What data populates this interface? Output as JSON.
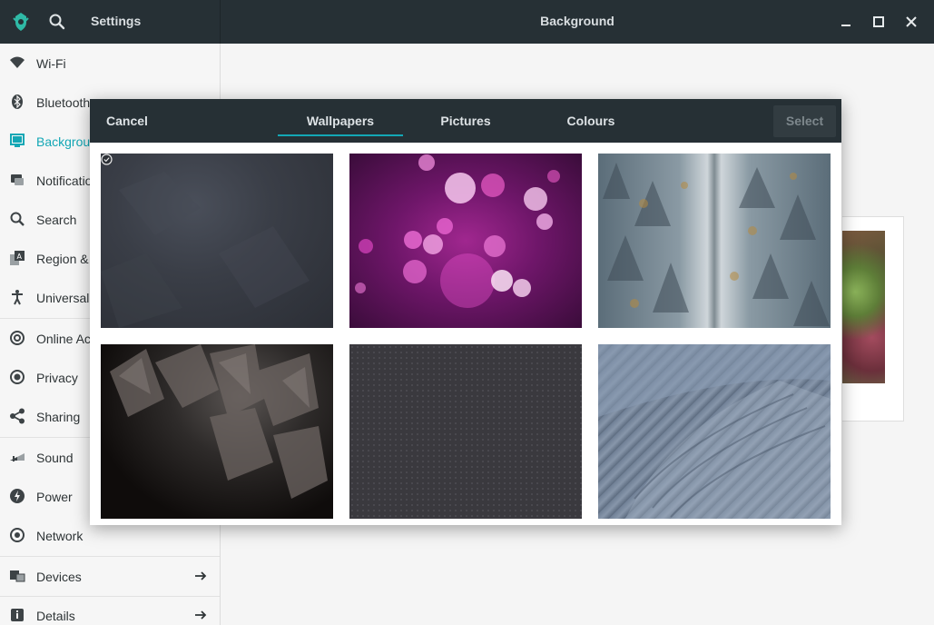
{
  "header": {
    "app_title": "Settings",
    "page_title": "Background",
    "icons": [
      "app-logo-icon",
      "search-icon",
      "minimize-icon",
      "maximize-icon",
      "close-icon"
    ]
  },
  "sidebar": {
    "items": [
      {
        "label": "Wi-Fi",
        "icon": "wifi-icon"
      },
      {
        "label": "Bluetooth",
        "icon": "bluetooth-icon"
      },
      {
        "label": "Background",
        "icon": "background-icon",
        "active": true
      },
      {
        "label": "Notifications",
        "icon": "notifications-icon"
      },
      {
        "label": "Search",
        "icon": "search-icon"
      },
      {
        "label": "Region & Language",
        "icon": "region-icon"
      },
      {
        "label": "Universal Access",
        "icon": "universal-access-icon"
      },
      {
        "label": "Online Accounts",
        "icon": "online-accounts-icon"
      },
      {
        "label": "Privacy",
        "icon": "privacy-icon"
      },
      {
        "label": "Sharing",
        "icon": "sharing-icon"
      },
      {
        "label": "Sound",
        "icon": "sound-icon"
      },
      {
        "label": "Power",
        "icon": "power-icon"
      },
      {
        "label": "Network",
        "icon": "network-icon"
      },
      {
        "label": "Devices",
        "icon": "devices-icon",
        "arrow": true
      },
      {
        "label": "Details",
        "icon": "details-icon",
        "arrow": true
      }
    ],
    "accent_color": "#13a7b5"
  },
  "dialog": {
    "cancel_label": "Cancel",
    "tabs": [
      {
        "label": "Wallpapers",
        "selected": true
      },
      {
        "label": "Pictures",
        "selected": false
      },
      {
        "label": "Colours",
        "selected": false
      }
    ],
    "select_label": "Select",
    "select_enabled": false,
    "thumbnails": [
      {
        "name": "dark-grey-texture",
        "current": true
      },
      {
        "name": "pink-bokeh",
        "current": false
      },
      {
        "name": "snowy-forest-road",
        "current": false
      },
      {
        "name": "dark-leaves",
        "current": false
      },
      {
        "name": "dark-dotted-pattern",
        "current": false
      },
      {
        "name": "blue-knit",
        "current": false
      }
    ]
  },
  "colors": {
    "headerbar": "#263035",
    "accent": "#13a7b5",
    "sidebar_bg": "#f6f6f6"
  }
}
